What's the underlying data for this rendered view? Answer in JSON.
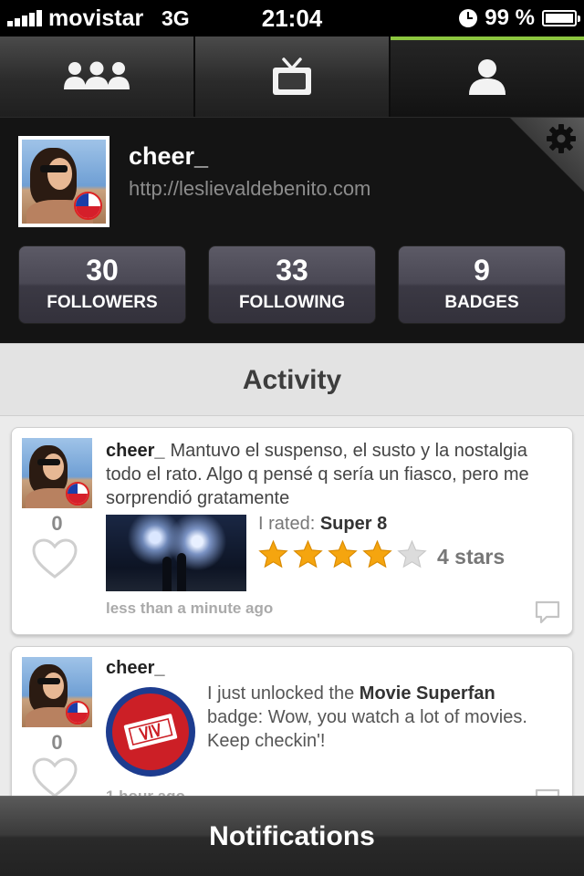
{
  "status_bar": {
    "carrier": "movistar",
    "network": "3G",
    "time": "21:04",
    "battery_percent": "99 %",
    "icons": [
      "signal-icon",
      "clock-icon",
      "battery-icon"
    ]
  },
  "tabs": [
    {
      "name": "people",
      "icon": "people-icon",
      "active": false
    },
    {
      "name": "tv",
      "icon": "tv-icon",
      "active": false
    },
    {
      "name": "profile",
      "icon": "person-icon",
      "active": true
    }
  ],
  "profile": {
    "username": "cheer_",
    "url": "http://leslievaldebenito.com",
    "settings_icon": "gear-icon"
  },
  "stats": [
    {
      "value": "30",
      "label": "FOLLOWERS"
    },
    {
      "value": "33",
      "label": "FOLLOWING"
    },
    {
      "value": "9",
      "label": "BADGES"
    }
  ],
  "activity": {
    "title": "Activity",
    "items": [
      {
        "user": "cheer_",
        "text": "Mantuvo el suspenso, el susto y la nostalgia todo el rato. Algo q pensé q sería un fiasco, pero me sorprendió gratamente",
        "likes": "0",
        "rated_prefix": "I rated:",
        "movie": "Super 8",
        "rating": 4,
        "rating_max": 5,
        "rating_label": "4 stars",
        "time": "less than a minute ago"
      },
      {
        "user": "cheer_",
        "text_prefix": "I just unlocked the",
        "badge_name": "Movie Superfan",
        "text_suffix": "badge: Wow, you watch a lot of movies. Keep checkin'!",
        "likes": "0",
        "time": "1 hour ago"
      }
    ]
  },
  "bottom_bar": {
    "label": "Notifications"
  }
}
